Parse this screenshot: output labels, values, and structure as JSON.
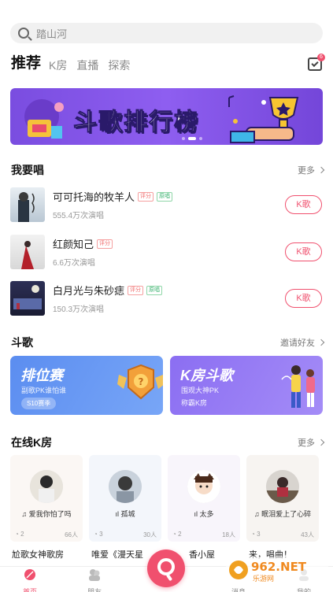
{
  "search": {
    "placeholder": "踏山河"
  },
  "tabs": [
    {
      "label": "推荐",
      "active": true
    },
    {
      "label": "K房"
    },
    {
      "label": "直播"
    },
    {
      "label": "探索"
    }
  ],
  "inbox": {
    "icon": "inbox-check-icon",
    "badge": "6"
  },
  "banner": {
    "title": "斗歌排行榜",
    "slide": 2,
    "slide_count": 3
  },
  "sing": {
    "title": "我要唱",
    "more": "更多",
    "songs": [
      {
        "title": "可可托海的牧羊人",
        "tags": [
          "评分",
          "原唱"
        ],
        "plays": "555.4万次演唱",
        "button": "K歌"
      },
      {
        "title": "红颜知己",
        "tags": [
          "评分"
        ],
        "plays": "6.6万次演唱",
        "button": "K歌"
      },
      {
        "title": "白月光与朱砂痣",
        "tags": [
          "评分",
          "原唱"
        ],
        "plays": "150.3万次演唱",
        "button": "K歌"
      }
    ]
  },
  "duel": {
    "title": "斗歌",
    "more": "邀请好友",
    "cards": [
      {
        "title": "排位赛",
        "sub": "副歌PK谁怕谁",
        "pill": "S10赛季",
        "color": "#5b8df0"
      },
      {
        "title": "K房斗歌",
        "sub": "围观大神PK",
        "sub2": "称霸K房",
        "color": "#8b6ef2"
      }
    ]
  },
  "rooms": {
    "title": "在线K房",
    "more": "更多",
    "items": [
      {
        "name": "爱我你怕了吗",
        "rank": "2",
        "count": "66人",
        "title": "尬歌女神歌房"
      },
      {
        "name": "孤城",
        "rank": "3",
        "count": "30人",
        "title": "唯爱《漫天星"
      },
      {
        "name": "太多",
        "rank": "2",
        "count": "18人",
        "title": "香小屋"
      },
      {
        "name": "眠泪爱上了心碎",
        "rank": "3",
        "count": "43人",
        "title": "来，唱曲！"
      }
    ]
  },
  "tabbar": {
    "home": "首页",
    "friends": "朋友",
    "messages": "消息",
    "me": "我的"
  },
  "colors": {
    "accent": "#f0506e",
    "banner": "#8e5ef0"
  },
  "watermark": "962.NET 乐游网"
}
